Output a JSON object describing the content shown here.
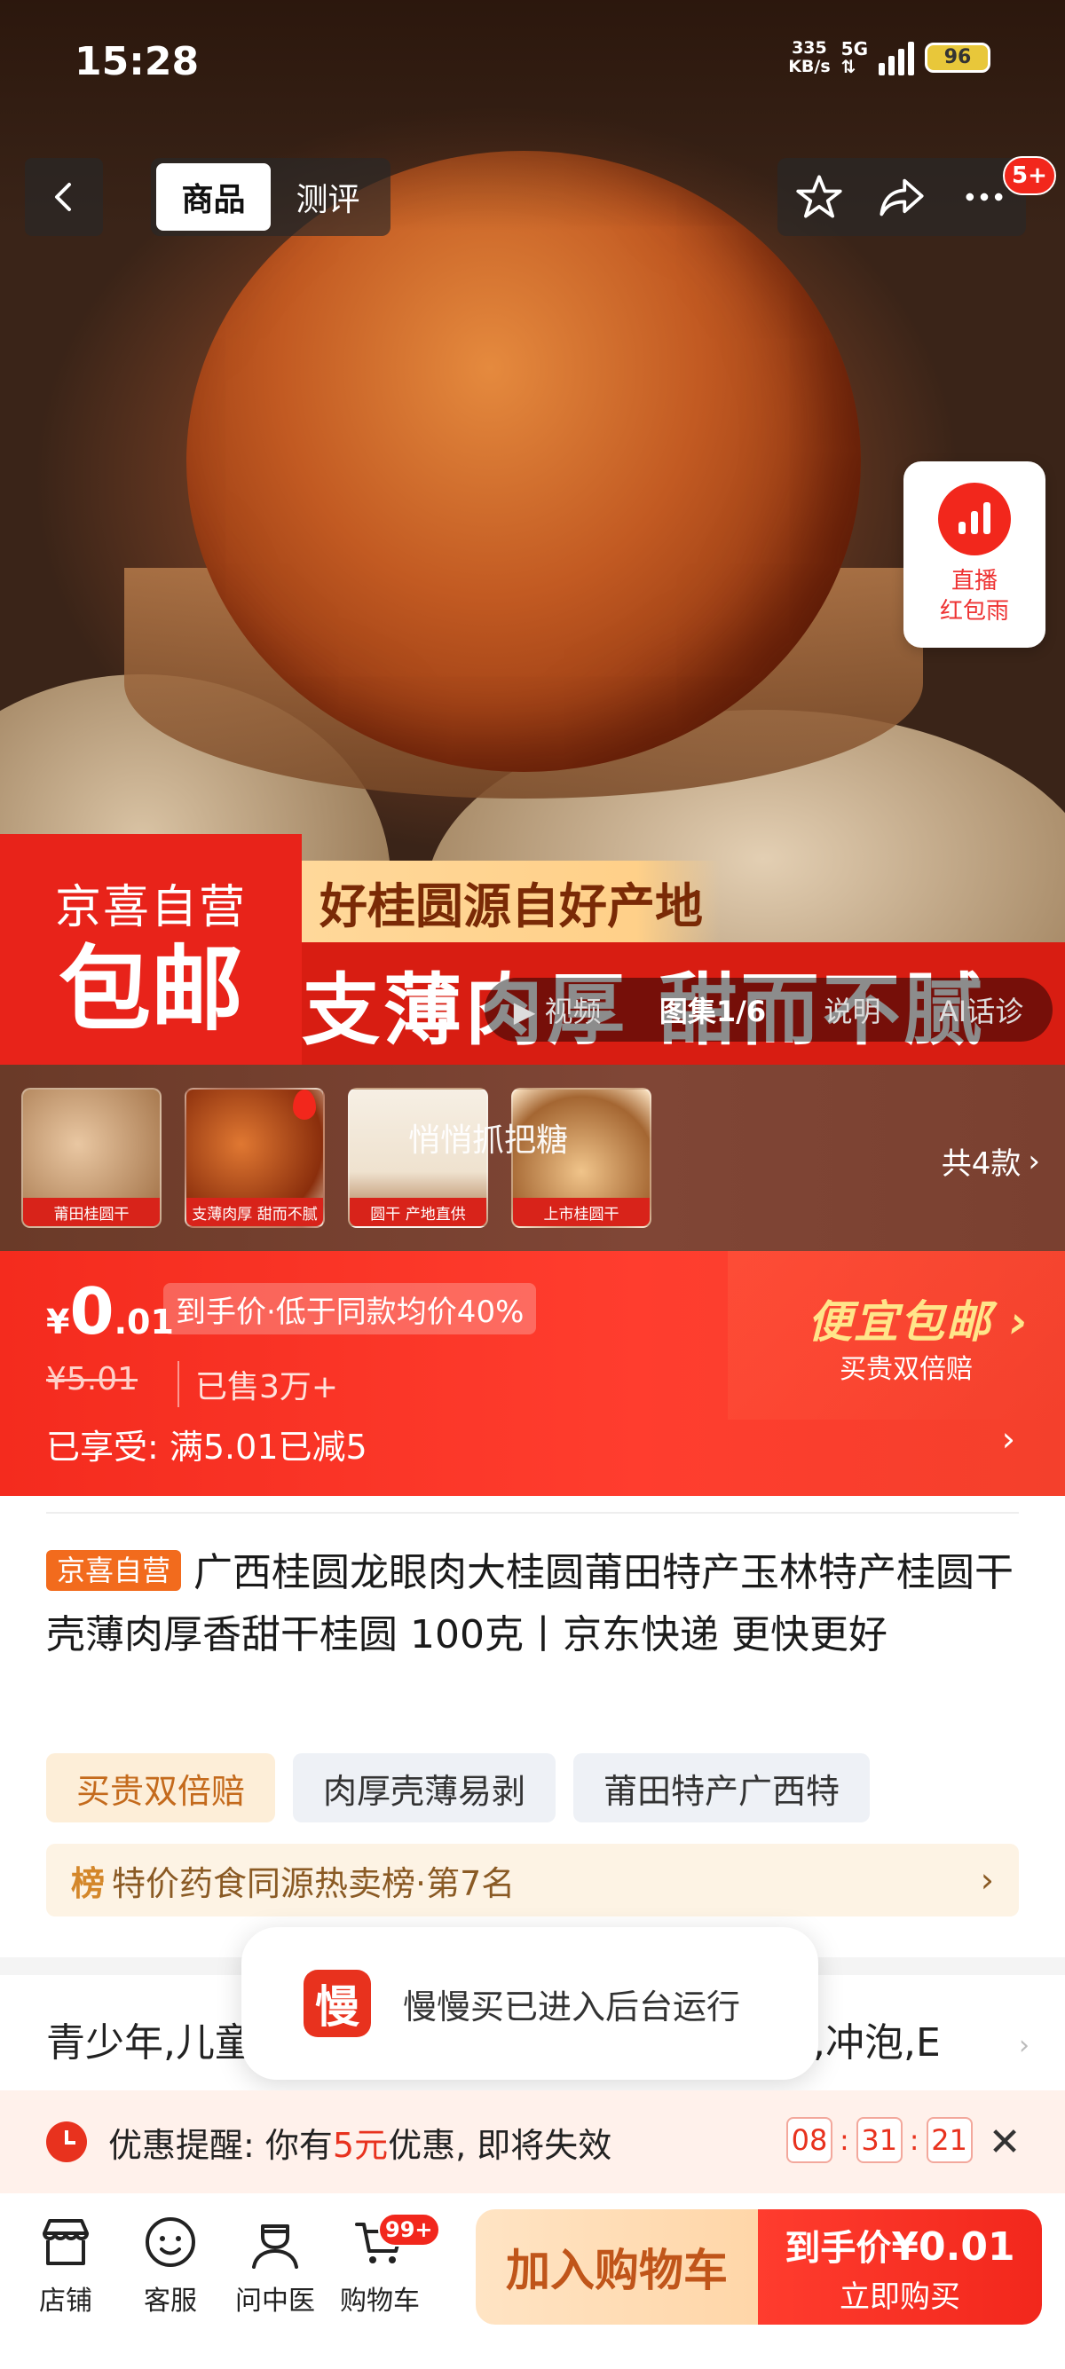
{
  "status_bar": {
    "time": "15:28",
    "net_speed": "335",
    "net_unit": "KB/s",
    "network": "5G",
    "battery": "96"
  },
  "nav": {
    "tabs": [
      {
        "label": "商品",
        "active": true
      },
      {
        "label": "测评",
        "active": false
      }
    ],
    "message_badge": "5+",
    "icons": [
      "back-icon",
      "star-icon",
      "share-icon",
      "more-icon"
    ]
  },
  "live_float": {
    "line1": "直播",
    "line2": "红包雨"
  },
  "hero": {
    "store_tag": "京喜自营",
    "free_shipping": "包邮",
    "slogan1": "好桂圆源自好产地",
    "slogan2": "支薄肉厚 甜而不腻",
    "media_tabs": [
      {
        "label": "视频",
        "icon": "play-icon",
        "active": false
      },
      {
        "label": "图集1/6",
        "active": true
      },
      {
        "label": "说明",
        "active": false
      },
      {
        "label": "AI话诊",
        "active": false
      }
    ]
  },
  "thumbnails": {
    "items": [
      {
        "caption": "莆田桂圆干"
      },
      {
        "caption": "支薄肉厚 甜而不腻"
      },
      {
        "caption": "圆干 产地直供"
      },
      {
        "caption": "上市桂圆干"
      }
    ],
    "overlay_text": "悄悄抓把糖",
    "variants_label": "共4款"
  },
  "price": {
    "currency": "¥",
    "integer": "0",
    "decimal": ".01",
    "tag": "到手价·低于同款均价40%",
    "original": "¥5.01",
    "sold": "已售3万+",
    "enjoy": "已享受: 满5.01已减5",
    "promo_title": "便宜包邮",
    "promo_sub": "买贵双倍赔"
  },
  "product": {
    "store_tag": "京喜自营",
    "title": "广西桂圆龙眼肉大桂圆莆田特产玉林特产桂圆干壳薄肉厚香甜干桂圆 100克丨京东快递 更快更好",
    "chips": [
      "买贵双倍赔",
      "肉厚壳薄易剥",
      "莆田特产广西特"
    ],
    "rank_prefix": "榜",
    "rank_text": "特价药食同源热卖榜·第7名"
  },
  "next_section": {
    "left_text": "青少年,儿童",
    "right_text": "煮,冲泡,E"
  },
  "toast": {
    "icon_text": "慢",
    "text": "慢慢买已进入后台运行"
  },
  "coupon": {
    "label": "优惠提醒:",
    "text_before": "你有",
    "amount": "5元",
    "text_after": "优惠, 即将失效",
    "hours": "08",
    "minutes": "31",
    "seconds": "21"
  },
  "bottom_bar": {
    "items": [
      {
        "label": "店铺",
        "icon": "store-icon"
      },
      {
        "label": "客服",
        "icon": "service-icon"
      },
      {
        "label": "问中医",
        "icon": "doctor-icon"
      },
      {
        "label": "购物车",
        "icon": "cart-icon"
      }
    ],
    "cart_badge": "99+",
    "add_cart": "加入购物车",
    "buy_line1_prefix": "到手价",
    "buy_price": "¥0.01",
    "buy_line2": "立即购买"
  },
  "colors": {
    "brand_red": "#f2271c",
    "accent_orange": "#f26b1d",
    "promo_yellow": "#ffe58a"
  }
}
